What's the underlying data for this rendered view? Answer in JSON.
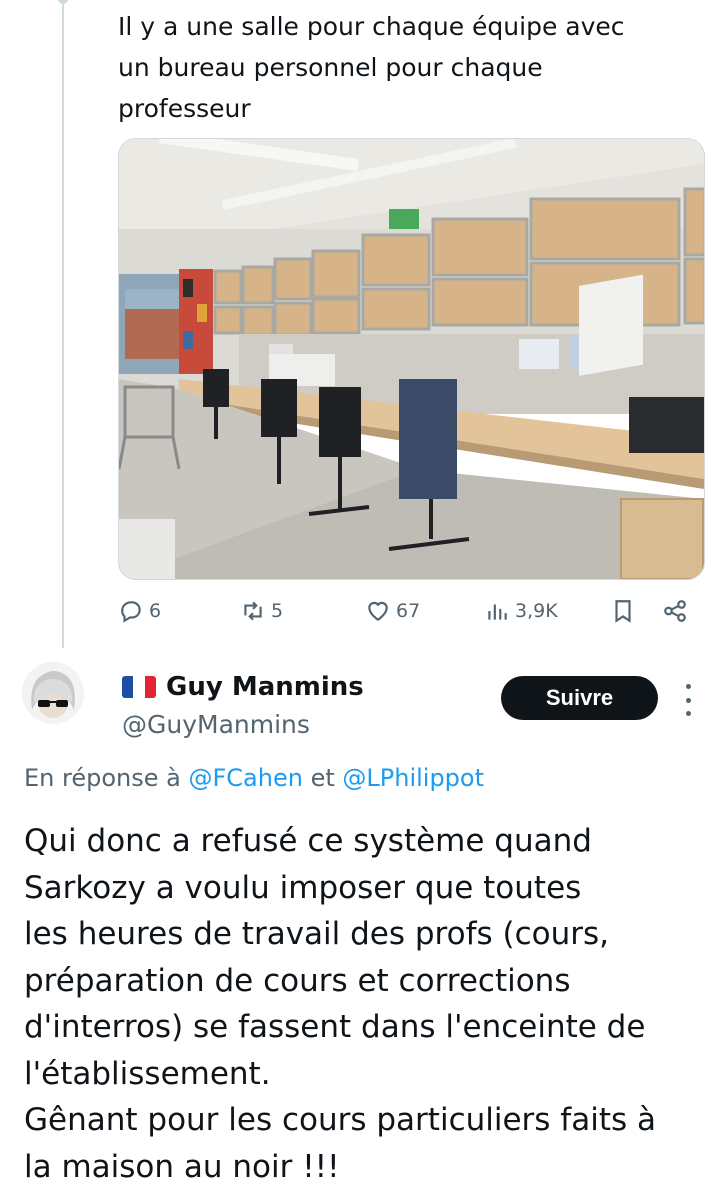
{
  "parent_tweet": {
    "text": "Il y a une salle pour chaque équipe avec\nun bureau personnel pour chaque\nprofesseur",
    "image_alt": "Bureau partagé avec postes de travail et armoires",
    "actions": {
      "replies": "6",
      "retweets": "5",
      "likes": "67",
      "views": "3,9K"
    }
  },
  "reply_tweet": {
    "author": {
      "name": "Guy Manmins",
      "handle": "@GuyManmins"
    },
    "follow_label": "Suivre",
    "reply_to": {
      "prefix": "En réponse à ",
      "mention1": "@FCahen",
      "connector": " et ",
      "mention2": "@LPhilippot"
    },
    "text": "Qui donc a refusé ce système quand\nSarkozy a voulu imposer que toutes\nles heures de travail des profs (cours,\npréparation de cours et corrections\nd'interros) se fassent dans l'enceinte de\nl'établissement.\nGênant pour les cours particuliers faits à\nla maison au noir !!!"
  },
  "colors": {
    "text_primary": "#0f1419",
    "text_secondary": "#536471",
    "link": "#1d9bf0",
    "follow_bg": "#0f1419",
    "thread_line": "#cfd9de"
  },
  "icons": [
    "reply-icon",
    "retweet-icon",
    "like-icon",
    "views-icon",
    "bookmark-icon",
    "share-icon",
    "more-icon",
    "french-flag-icon"
  ]
}
